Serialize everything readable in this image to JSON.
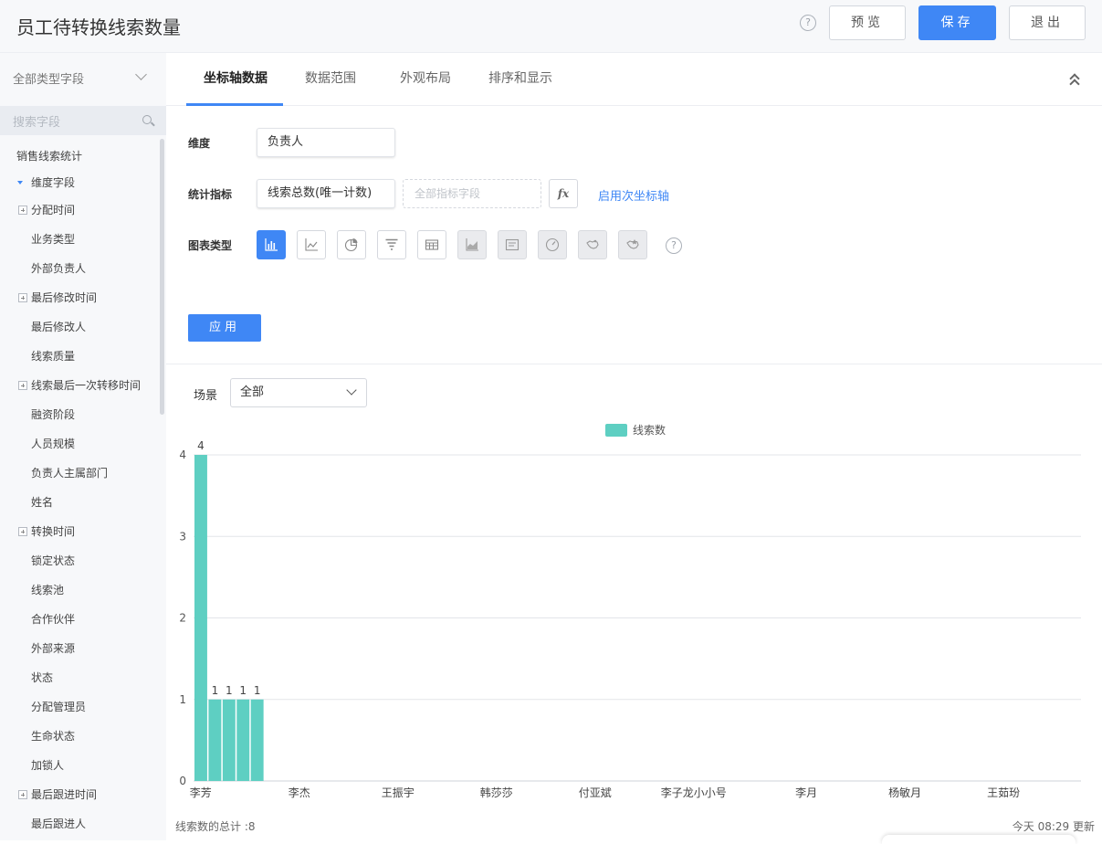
{
  "header": {
    "title": "员工待转换线索数量",
    "preview_label": "预览",
    "save_label": "保存",
    "exit_label": "退出"
  },
  "sidebar": {
    "filter_label": "全部类型字段",
    "search_placeholder": "搜索字段",
    "group_label": "销售线索统计",
    "section_label": "维度字段",
    "items": [
      {
        "label": "分配时间",
        "expandable": true
      },
      {
        "label": "业务类型",
        "expandable": false
      },
      {
        "label": "外部负责人",
        "expandable": false
      },
      {
        "label": "最后修改时间",
        "expandable": true
      },
      {
        "label": "最后修改人",
        "expandable": false
      },
      {
        "label": "线索质量",
        "expandable": false
      },
      {
        "label": "线索最后一次转移时间",
        "expandable": true
      },
      {
        "label": "融资阶段",
        "expandable": false
      },
      {
        "label": "人员规模",
        "expandable": false
      },
      {
        "label": "负责人主属部门",
        "expandable": false
      },
      {
        "label": "姓名",
        "expandable": false
      },
      {
        "label": "转换时间",
        "expandable": true
      },
      {
        "label": "锁定状态",
        "expandable": false
      },
      {
        "label": "线索池",
        "expandable": false
      },
      {
        "label": "合作伙伴",
        "expandable": false
      },
      {
        "label": "外部来源",
        "expandable": false
      },
      {
        "label": "状态",
        "expandable": false
      },
      {
        "label": "分配管理员",
        "expandable": false
      },
      {
        "label": "生命状态",
        "expandable": false
      },
      {
        "label": "加锁人",
        "expandable": false
      },
      {
        "label": "最后跟进时间",
        "expandable": true
      },
      {
        "label": "最后跟进人",
        "expandable": false
      }
    ]
  },
  "tabs": [
    {
      "label": "坐标轴数据",
      "active": true
    },
    {
      "label": "数据范围",
      "active": false
    },
    {
      "label": "外观布局",
      "active": false
    },
    {
      "label": "排序和显示",
      "active": false
    }
  ],
  "form": {
    "dimension_label": "维度",
    "dimension_value": "负责人",
    "metric_label": "统计指标",
    "metric_value": "线索总数(唯一计数)",
    "metric_placeholder": "全部指标字段",
    "fx_label": "fx",
    "secondary_axis_link": "启用次坐标轴",
    "chart_type_label": "图表类型",
    "chart_types": [
      "bar-chart-icon",
      "line-chart-icon",
      "pie-chart-icon",
      "funnel-chart-icon",
      "table-chart-icon",
      "area-chart-icon",
      "text-card-icon",
      "gauge-chart-icon",
      "map-chart-icon",
      "region-map-icon"
    ],
    "help_icon": "question-icon",
    "apply_label": "应用"
  },
  "scene": {
    "label": "场景",
    "value": "全部"
  },
  "chart_data": {
    "type": "bar",
    "legend": "线索数",
    "color": "#5ecfc2",
    "categories": [
      "李芳",
      "",
      "",
      "",
      "",
      "",
      "",
      "李杰",
      "",
      "",
      "",
      "",
      "",
      "",
      "王振宇",
      "",
      "",
      "",
      "",
      "",
      "",
      "韩莎莎",
      "",
      "",
      "",
      "",
      "",
      "",
      "付亚斌",
      "",
      "",
      "",
      "",
      "",
      "",
      "李子龙小小号",
      "",
      "",
      "",
      "",
      "",
      "",
      "",
      "李月",
      "",
      "",
      "",
      "",
      "",
      "",
      "杨敏月",
      "",
      "",
      "",
      "",
      "",
      "",
      "王茹玢",
      "",
      "",
      "",
      "",
      "",
      "",
      ""
    ],
    "bars": [
      {
        "index": 0,
        "value": 4
      },
      {
        "index": 1,
        "value": 1
      },
      {
        "index": 2,
        "value": 1
      },
      {
        "index": 3,
        "value": 1
      },
      {
        "index": 4,
        "value": 1
      }
    ],
    "category_count": 63,
    "y_ticks": [
      0,
      1,
      2,
      3,
      4
    ],
    "ylim": [
      0,
      4
    ],
    "grid": true,
    "legend_position": "top-center"
  },
  "footer": {
    "total": "线索数的总计 :8",
    "updated": "今天 08:29 更新"
  }
}
